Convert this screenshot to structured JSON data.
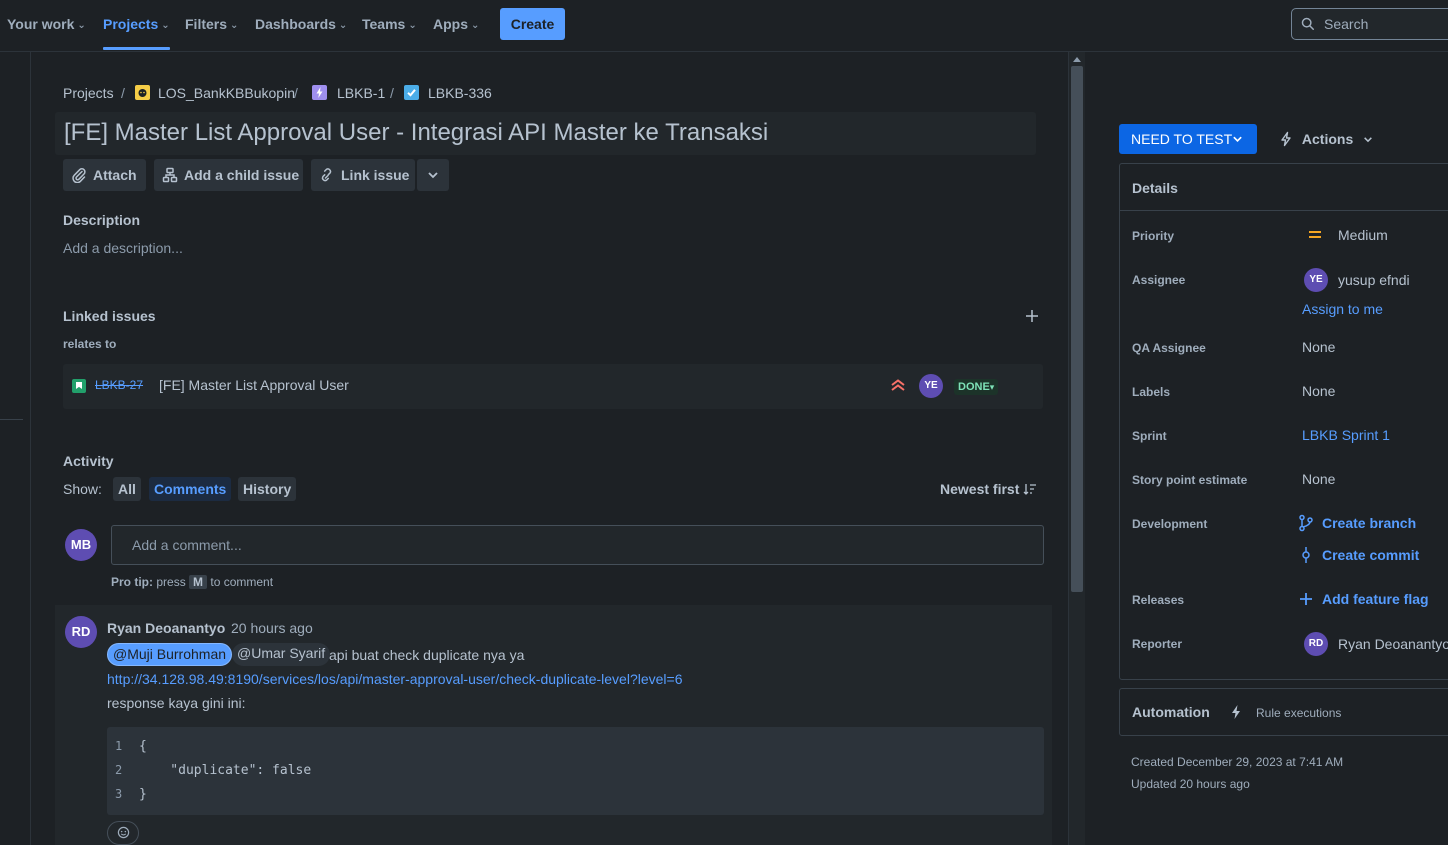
{
  "nav": {
    "your_work": "Your work",
    "projects": "Projects",
    "filters": "Filters",
    "dashboards": "Dashboards",
    "teams": "Teams",
    "apps": "Apps",
    "create": "Create",
    "search_placeholder": "Search"
  },
  "breadcrumb": {
    "projects": "Projects",
    "project": "LOS_BankKBBukopin",
    "epic": "LBKB-1",
    "issue": "LBKB-336"
  },
  "issue": {
    "title": "[FE] Master List Approval User - Integrasi API Master ke Transaksi"
  },
  "toolbar": {
    "attach": "Attach",
    "add_child": "Add a child issue",
    "link_issue": "Link issue"
  },
  "description": {
    "heading": "Description",
    "placeholder": "Add a description..."
  },
  "linked": {
    "heading": "Linked issues",
    "relation": "relates to",
    "items": [
      {
        "key": "LBKB-27",
        "summary": "[FE] Master List Approval User",
        "assignee_initials": "YE",
        "status": "DONE"
      }
    ]
  },
  "activity": {
    "heading": "Activity",
    "show_label": "Show:",
    "filters": [
      "All",
      "Comments",
      "History"
    ],
    "selected_filter": "Comments",
    "sort": "Newest first",
    "current_user_initials": "MB",
    "comment_placeholder": "Add a comment...",
    "pro_tip_label": "Pro tip:",
    "pro_tip_press": "press",
    "pro_tip_key": "M",
    "pro_tip_suffix": "to comment",
    "comments": [
      {
        "author_initials": "RD",
        "author": "Ryan Deoanantyo",
        "time": "20 hours ago",
        "mention1": "@Muji Burrohman",
        "mention2": "@Umar Syarif",
        "text1": "api buat check duplicate nya ya",
        "link": "http://34.128.98.49:8190/services/los/api/master-approval-user/check-duplicate-level?level=6",
        "text2": "response kaya gini ini:",
        "code_lines": [
          "{",
          "    \"duplicate\": false",
          "}"
        ],
        "line_numbers": [
          "1",
          "2",
          "3"
        ]
      }
    ]
  },
  "side": {
    "status": "NEED TO TEST",
    "actions": "Actions",
    "details_heading": "Details",
    "priority_label": "Priority",
    "priority_value": "Medium",
    "assignee_label": "Assignee",
    "assignee_initials": "YE",
    "assignee_name": "yusup efndi",
    "assign_to_me": "Assign to me",
    "qa_label": "QA Assignee",
    "qa_value": "None",
    "labels_label": "Labels",
    "labels_value": "None",
    "sprint_label": "Sprint",
    "sprint_value": "LBKB Sprint 1",
    "story_points_label": "Story point estimate",
    "story_points_value": "None",
    "development_label": "Development",
    "create_branch": "Create branch",
    "create_commit": "Create commit",
    "releases_label": "Releases",
    "add_feature_flag": "Add feature flag",
    "reporter_label": "Reporter",
    "reporter_initials": "RD",
    "reporter_name": "Ryan Deoanantyo",
    "automation_heading": "Automation",
    "rule_executions": "Rule executions",
    "created": "Created December 29, 2023 at 7:41 AM",
    "updated": "Updated 20 hours ago"
  },
  "colors": {
    "accent": "#579dff",
    "status_button": "#0c66e4",
    "done_text": "#7ee2b8",
    "priority_medium": "#f5a623"
  }
}
